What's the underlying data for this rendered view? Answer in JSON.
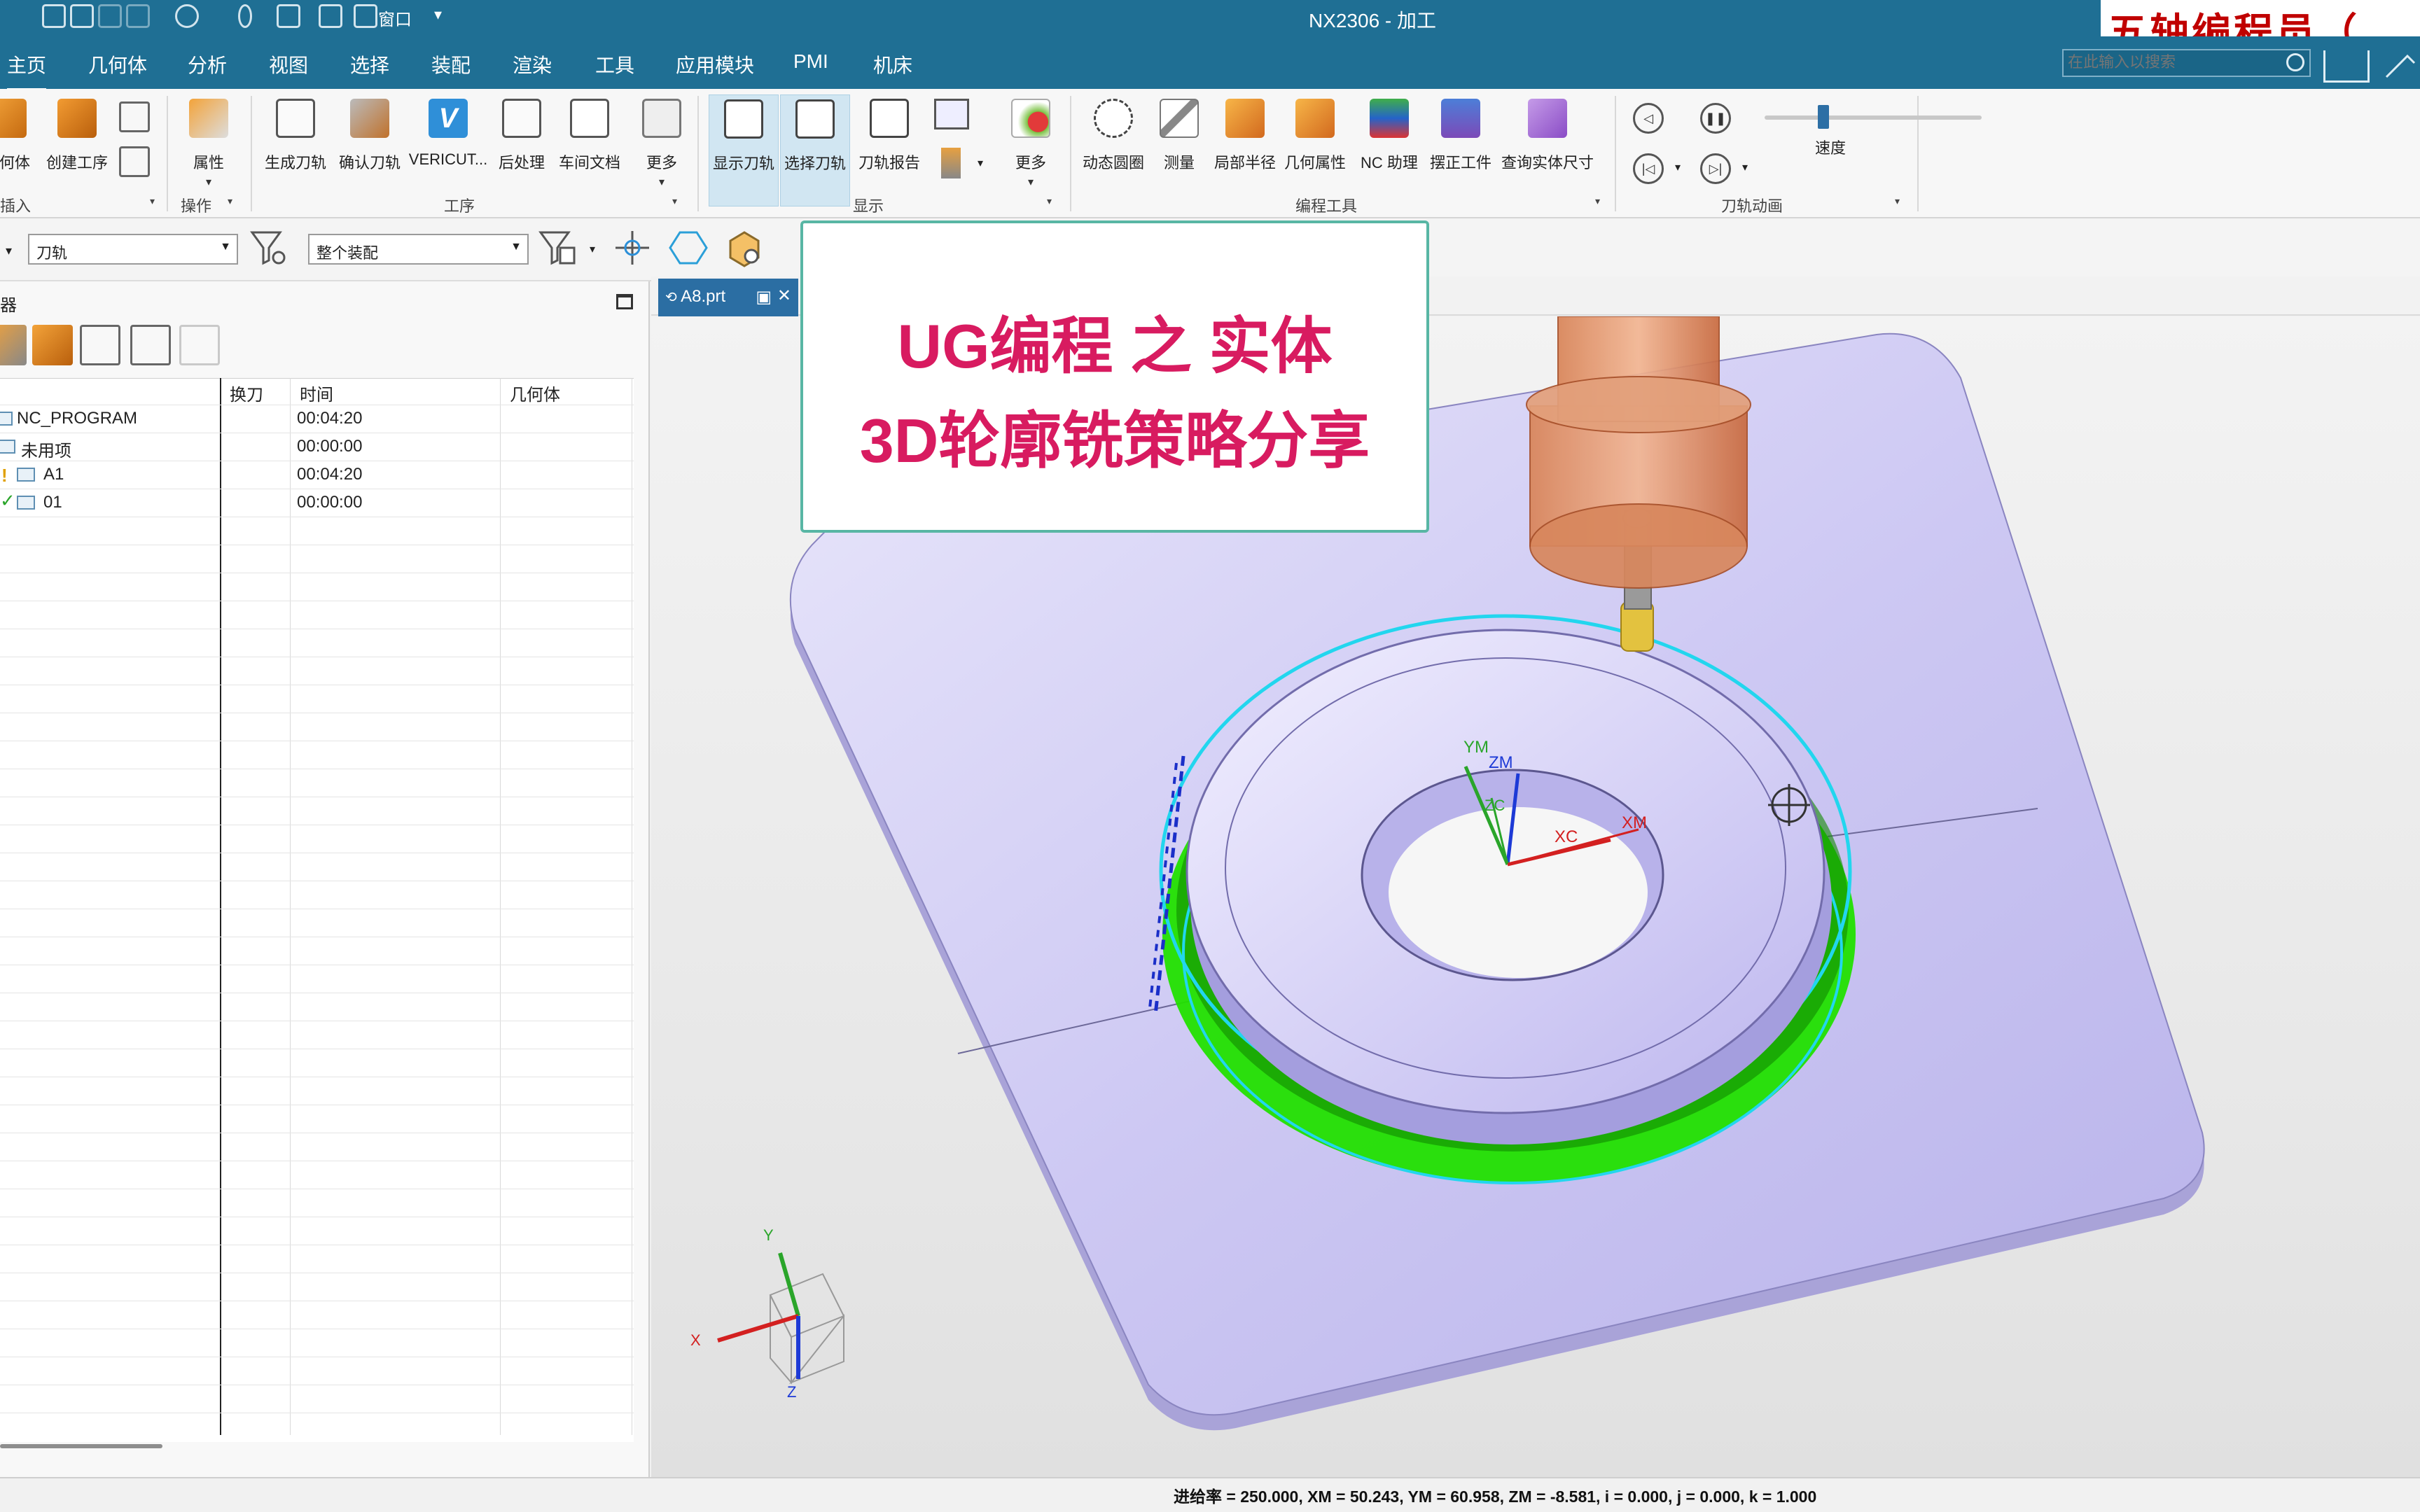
{
  "window": {
    "title": "NX2306 - 加工"
  },
  "watermark": {
    "text": "五轴编程员（"
  },
  "menu": {
    "items": [
      "主页",
      "几何体",
      "分析",
      "视图",
      "选择",
      "装配",
      "渲染",
      "工具",
      "应用模块",
      "PMI",
      "机床"
    ],
    "window_menu": "窗口"
  },
  "search": {
    "placeholder": "在此输入以搜索"
  },
  "ribbon": {
    "insert_group": {
      "buttons": [
        "几何体",
        "创建工序"
      ],
      "label": "插入"
    },
    "ops_group": {
      "buttons": [
        "属性"
      ],
      "label": "操作"
    },
    "process_group": {
      "buttons": [
        "生成刀轨",
        "确认刀轨",
        "VERICUT...",
        "后处理",
        "车间文档",
        "更多"
      ],
      "label": "工序"
    },
    "display_group": {
      "buttons": [
        "显示刀轨",
        "选择刀轨",
        "刀轨报告",
        "更多"
      ],
      "label": "显示"
    },
    "tools_group": {
      "buttons": [
        "动态圆圈",
        "测量",
        "局部半径",
        "几何属性",
        "NC 助理",
        "摆正工件",
        "查询实体尺寸"
      ],
      "label": "编程工具"
    },
    "animation_group": {
      "speed_label": "速度",
      "label": "刀轨动画",
      "speed_level": 0.27
    }
  },
  "filter": {
    "type_filter": "刀轨",
    "scope_filter": "整个装配"
  },
  "navigator": {
    "title": "器",
    "columns": [
      "换刀",
      "时间",
      "几何体"
    ],
    "rows": [
      {
        "name": "NC_PROGRAM",
        "time": "00:04:20"
      },
      {
        "name": "未用项",
        "time": "00:00:00"
      },
      {
        "name": "A1",
        "time": "00:04:20"
      },
      {
        "name": "01",
        "time": "00:00:00"
      }
    ]
  },
  "graphics": {
    "tab": "A8.prt",
    "overlay": {
      "line1": "UG编程 之 实体",
      "line2": "3D轮廓铣策略分享"
    },
    "wcs": {
      "ym": "YM",
      "zm": "ZM",
      "zc": "ZC",
      "xc": "XC",
      "xm": "XM"
    },
    "triad": {
      "x": "X",
      "y": "Y",
      "z": "Z"
    }
  },
  "status": {
    "text": "进给率 = 250.000, XM = 50.243, YM = 60.958, ZM = -8.581, i = 0.000, j = 0.000, k = 1.000"
  },
  "colors": {
    "titlebar": "#1f6f94",
    "accent": "#d81b60",
    "toolpath_green": "#22e000",
    "toolpath_cyan": "#22d6ee",
    "part": "#c9c5f0"
  }
}
